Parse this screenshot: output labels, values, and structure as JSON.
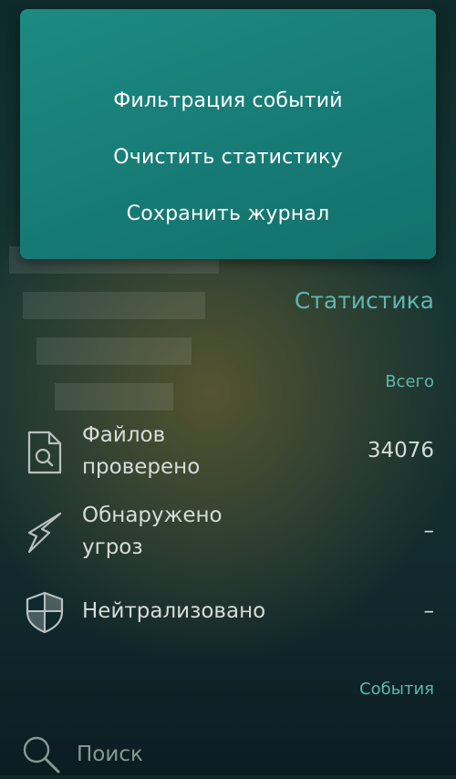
{
  "menu": {
    "items": [
      {
        "label": "Фильтрация событий"
      },
      {
        "label": "Очистить статистику"
      },
      {
        "label": "Сохранить журнал"
      }
    ]
  },
  "stats": {
    "title": "Статистика",
    "total_label": "Всего",
    "rows": [
      {
        "label_line1": "Файлов",
        "label_line2": "проверено",
        "value": "34076",
        "icon": "file-search-icon"
      },
      {
        "label_line1": "Обнаружено",
        "label_line2": "угроз",
        "value": "–",
        "icon": "lightning-icon"
      },
      {
        "label_line1": "Нейтрализовано",
        "label_line2": "",
        "value": "–",
        "icon": "shield-icon"
      }
    ]
  },
  "events": {
    "label": "События"
  },
  "search": {
    "placeholder": "Поиск",
    "icon": "search-icon"
  },
  "colors": {
    "menu_bg": "#1a847d",
    "accent": "#5fb7ae",
    "text": "#d6dcd8"
  }
}
